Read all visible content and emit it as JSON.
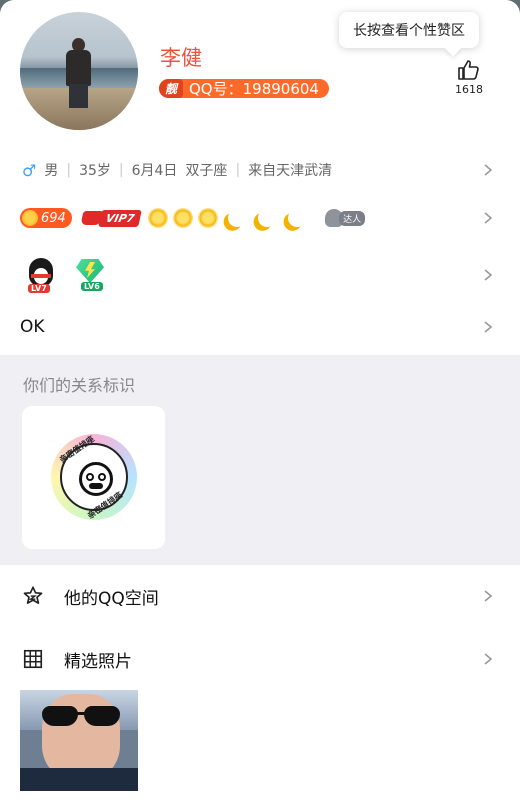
{
  "profile": {
    "name": "李健",
    "qq_badge_prefix": "靓",
    "qq_number_label": "QQ号：19890604"
  },
  "tooltip": "长按查看个性赞区",
  "like": {
    "count": "1618",
    "icon": "thumbs-up-icon"
  },
  "info": {
    "gender_icon": "♂",
    "gender": "男",
    "age": "35岁",
    "birthday": "6月4日",
    "zodiac": "双子座",
    "hometown": "来自天津武清"
  },
  "badges": {
    "coin_value": "694",
    "vip_label": "VIP7",
    "talent_label": "达人"
  },
  "levels": {
    "penguin_level": "LV7",
    "gem_level": "LV6"
  },
  "signature": "OK",
  "relationship": {
    "title": "你们的关系标识",
    "ring_text_top": "亲密值排座",
    "ring_text_bottom": "亲密值排座"
  },
  "menu": {
    "qzone_label": "他的QQ空间",
    "photos_label": "精选照片"
  },
  "colors": {
    "accent": "#f0523b",
    "qq_badge": "#ff6a2b",
    "vip_red": "#e02a2a",
    "section_gray": "#f0f0f4"
  }
}
